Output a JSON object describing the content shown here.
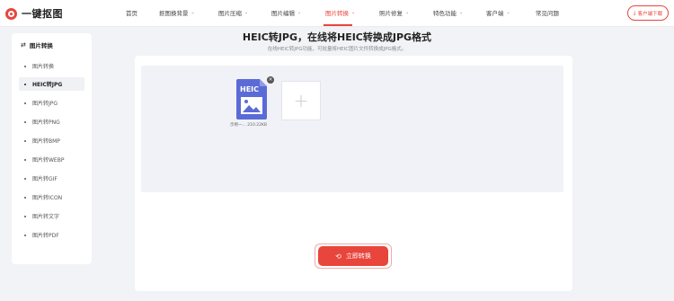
{
  "header": {
    "brand": "一键抠图",
    "nav": [
      {
        "label": "首页",
        "chevron": false
      },
      {
        "label": "抠图换背景",
        "chevron": true
      },
      {
        "label": "图片压缩",
        "chevron": true
      },
      {
        "label": "图片编辑",
        "chevron": true
      },
      {
        "label": "图片转换",
        "chevron": true,
        "active": true
      },
      {
        "label": "照片修复",
        "chevron": true
      },
      {
        "label": "特色功能",
        "chevron": true
      },
      {
        "label": "客户端",
        "chevron": true
      },
      {
        "label": "常见问题",
        "chevron": false
      }
    ],
    "download_label": "客户端下载"
  },
  "sidebar": {
    "title": "图片转换",
    "items": [
      {
        "label": "图片转换"
      },
      {
        "label": "HEIC转JPG",
        "active": true
      },
      {
        "label": "图片转JPG"
      },
      {
        "label": "图片转PNG"
      },
      {
        "label": "图片转BMP"
      },
      {
        "label": "图片转WEBP"
      },
      {
        "label": "图片转GIF"
      },
      {
        "label": "图片转ICON"
      },
      {
        "label": "图片转文字"
      },
      {
        "label": "图片转PDF"
      }
    ]
  },
  "main": {
    "title": "HEIC转JPG，在线将HEIC转换成JPG格式",
    "subtitle": "在线HEIC转JPG功能，可批量将HEIC图片文件转换成JPG格式。",
    "file": {
      "badge": "HEIC",
      "name": "示例一... 210.22KB"
    },
    "convert_label": "立即转换"
  },
  "colors": {
    "accent": "#e8453c",
    "file_icon": "#5b6bd6"
  },
  "icons": {
    "logo": "logo-mark",
    "download": "download-icon",
    "sidebar_head": "convert-icon",
    "close": "close-icon",
    "add": "plus-icon",
    "convert": "chat-convert-icon"
  }
}
